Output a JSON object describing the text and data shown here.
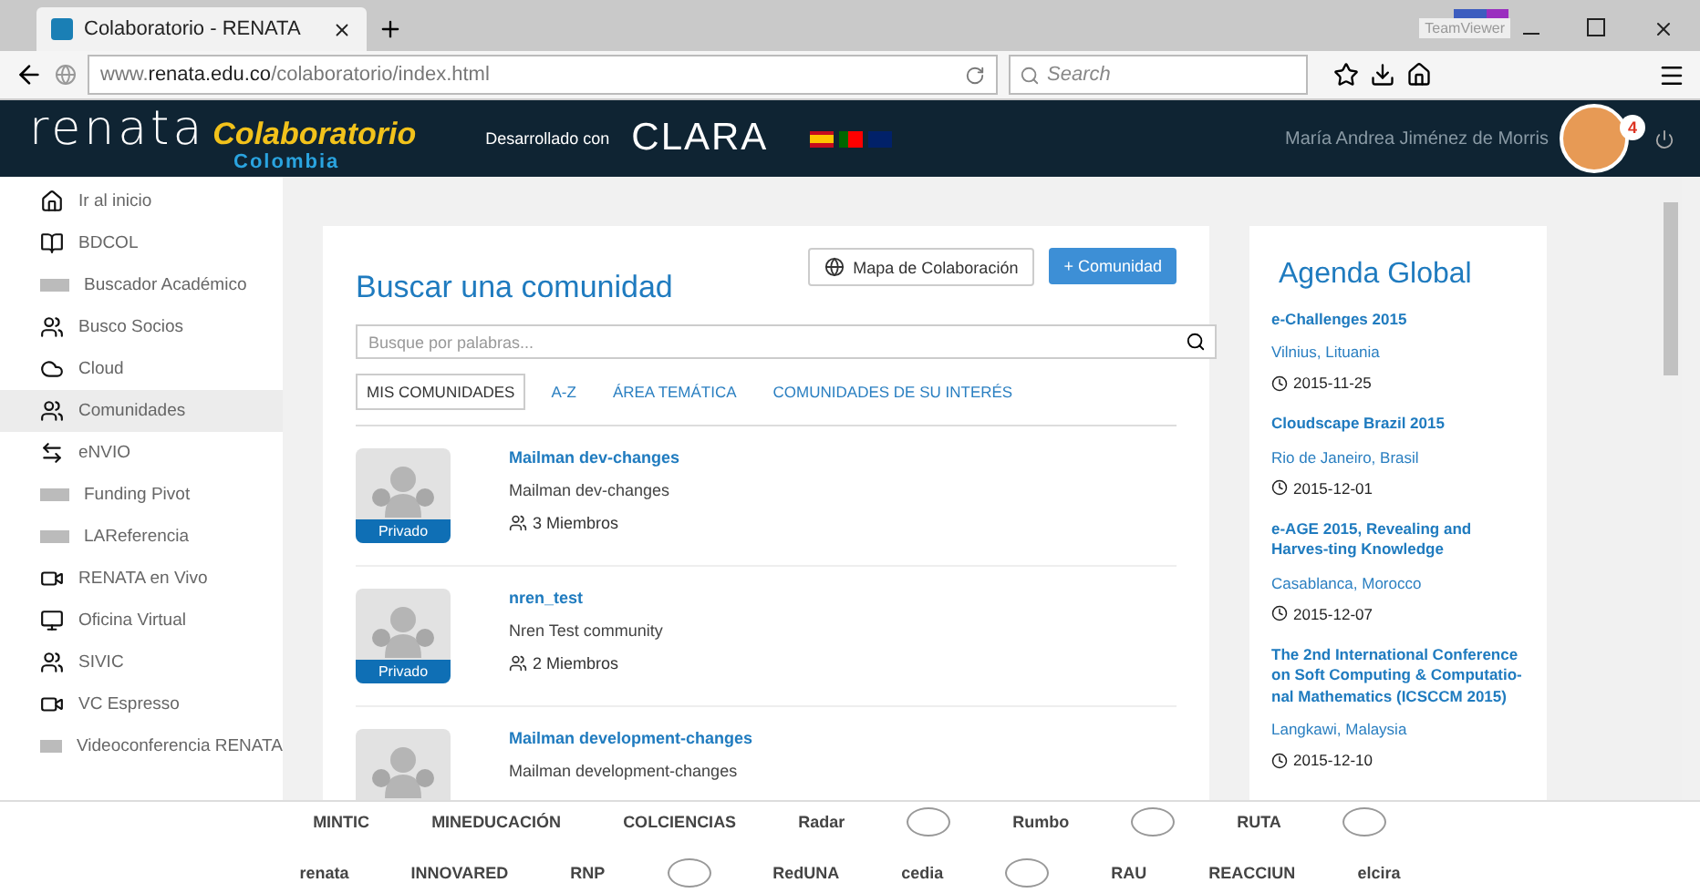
{
  "browser": {
    "tab_title": "Colaboratorio - RENATA",
    "url_prefix": "www.",
    "url_host": "renata.edu.co",
    "url_path": "/colaboratorio/index.html",
    "search_placeholder": "Search",
    "tooltip": "TeamViewer"
  },
  "header": {
    "logo": "renata",
    "logo_sub": "Colaboratorio",
    "logo_country": "Colombia",
    "developed_by": "Desarrollado con",
    "partner": "CLARA",
    "user_name": "María Andrea Jiménez de Morris",
    "notifications": "4"
  },
  "sidebar": {
    "items": [
      {
        "label": "Ir al inicio",
        "selected": false
      },
      {
        "label": "BDCOL",
        "selected": false
      },
      {
        "label": "Buscador Académico",
        "selected": false
      },
      {
        "label": "Busco Socios",
        "selected": false
      },
      {
        "label": "Cloud",
        "selected": false
      },
      {
        "label": "Comunidades",
        "selected": true
      },
      {
        "label": "eNVIO",
        "selected": false
      },
      {
        "label": "Funding Pivot",
        "selected": false
      },
      {
        "label": "LAReferencia",
        "selected": false
      },
      {
        "label": "RENATA en Vivo",
        "selected": false
      },
      {
        "label": "Oficina Virtual",
        "selected": false
      },
      {
        "label": "SIVIC",
        "selected": false
      },
      {
        "label": "VC Espresso",
        "selected": false
      },
      {
        "label": "Videoconferencia RENATA",
        "selected": false
      }
    ]
  },
  "main": {
    "title": "Buscar una comunidad",
    "map_button": "Mapa de Colaboración",
    "add_button": "+ Comunidad",
    "search": {
      "placeholder": "Busque por palabras..."
    },
    "tabs": [
      {
        "label": "MIS COMUNIDADES",
        "selected": true
      },
      {
        "label": "A-Z",
        "selected": false
      },
      {
        "label": "ÁREA TEMÁTICA",
        "selected": false
      },
      {
        "label": "COMUNIDADES DE SU INTERÉS",
        "selected": false
      }
    ],
    "communities": [
      {
        "name": "Mailman dev-changes",
        "description": "Mailman dev-changes",
        "badge": "Privado",
        "members": "3 Miembros"
      },
      {
        "name": "nren_test",
        "description": "Nren Test community",
        "badge": "Privado",
        "members": "2 Miembros"
      },
      {
        "name": "Mailman development-changes",
        "description": "Mailman development-changes"
      }
    ]
  },
  "agenda": {
    "title": "Agenda Global",
    "events": [
      {
        "title": "e-Challenges 2015",
        "place": "Vilnius, Lituania",
        "date": "2015-11-25"
      },
      {
        "title": "Cloudscape Brazil 2015",
        "place": "Rio de Janeiro, Brasil",
        "date": "2015-12-01"
      },
      {
        "title": "e-AGE 2015, Revealing and Harves-ting Knowledge",
        "place": "Casablanca, Morocco",
        "date": "2015-12-07"
      },
      {
        "title": "The 2nd International Conference on Soft Computing & Computatio-nal Mathematics (ICSCCM 2015)",
        "place": "Langkawi, Malaysia",
        "date": "2015-12-10"
      }
    ]
  },
  "footer": {
    "logos": [
      {
        "kind": "text",
        "label": "MINTIC"
      },
      {
        "kind": "text",
        "label": "MINEDUCACIÓN"
      },
      {
        "kind": "text",
        "label": "COLCIENCIAS"
      },
      {
        "kind": "text",
        "label": "Radar"
      },
      {
        "kind": "mark"
      },
      {
        "kind": "text",
        "label": "Rumbo"
      },
      {
        "kind": "mark"
      },
      {
        "kind": "text",
        "label": "RUTA"
      },
      {
        "kind": "mark"
      },
      {
        "kind": "break"
      },
      {
        "kind": "text",
        "label": "renata"
      },
      {
        "kind": "text",
        "label": "INNOVARED"
      },
      {
        "kind": "text",
        "label": "RNP"
      },
      {
        "kind": "mark"
      },
      {
        "kind": "text",
        "label": "RedUNA"
      },
      {
        "kind": "text",
        "label": "cedia"
      },
      {
        "kind": "mark"
      },
      {
        "kind": "text",
        "label": "RAU"
      },
      {
        "kind": "text",
        "label": "REACCIUN"
      },
      {
        "kind": "text",
        "label": "elcira"
      }
    ]
  }
}
